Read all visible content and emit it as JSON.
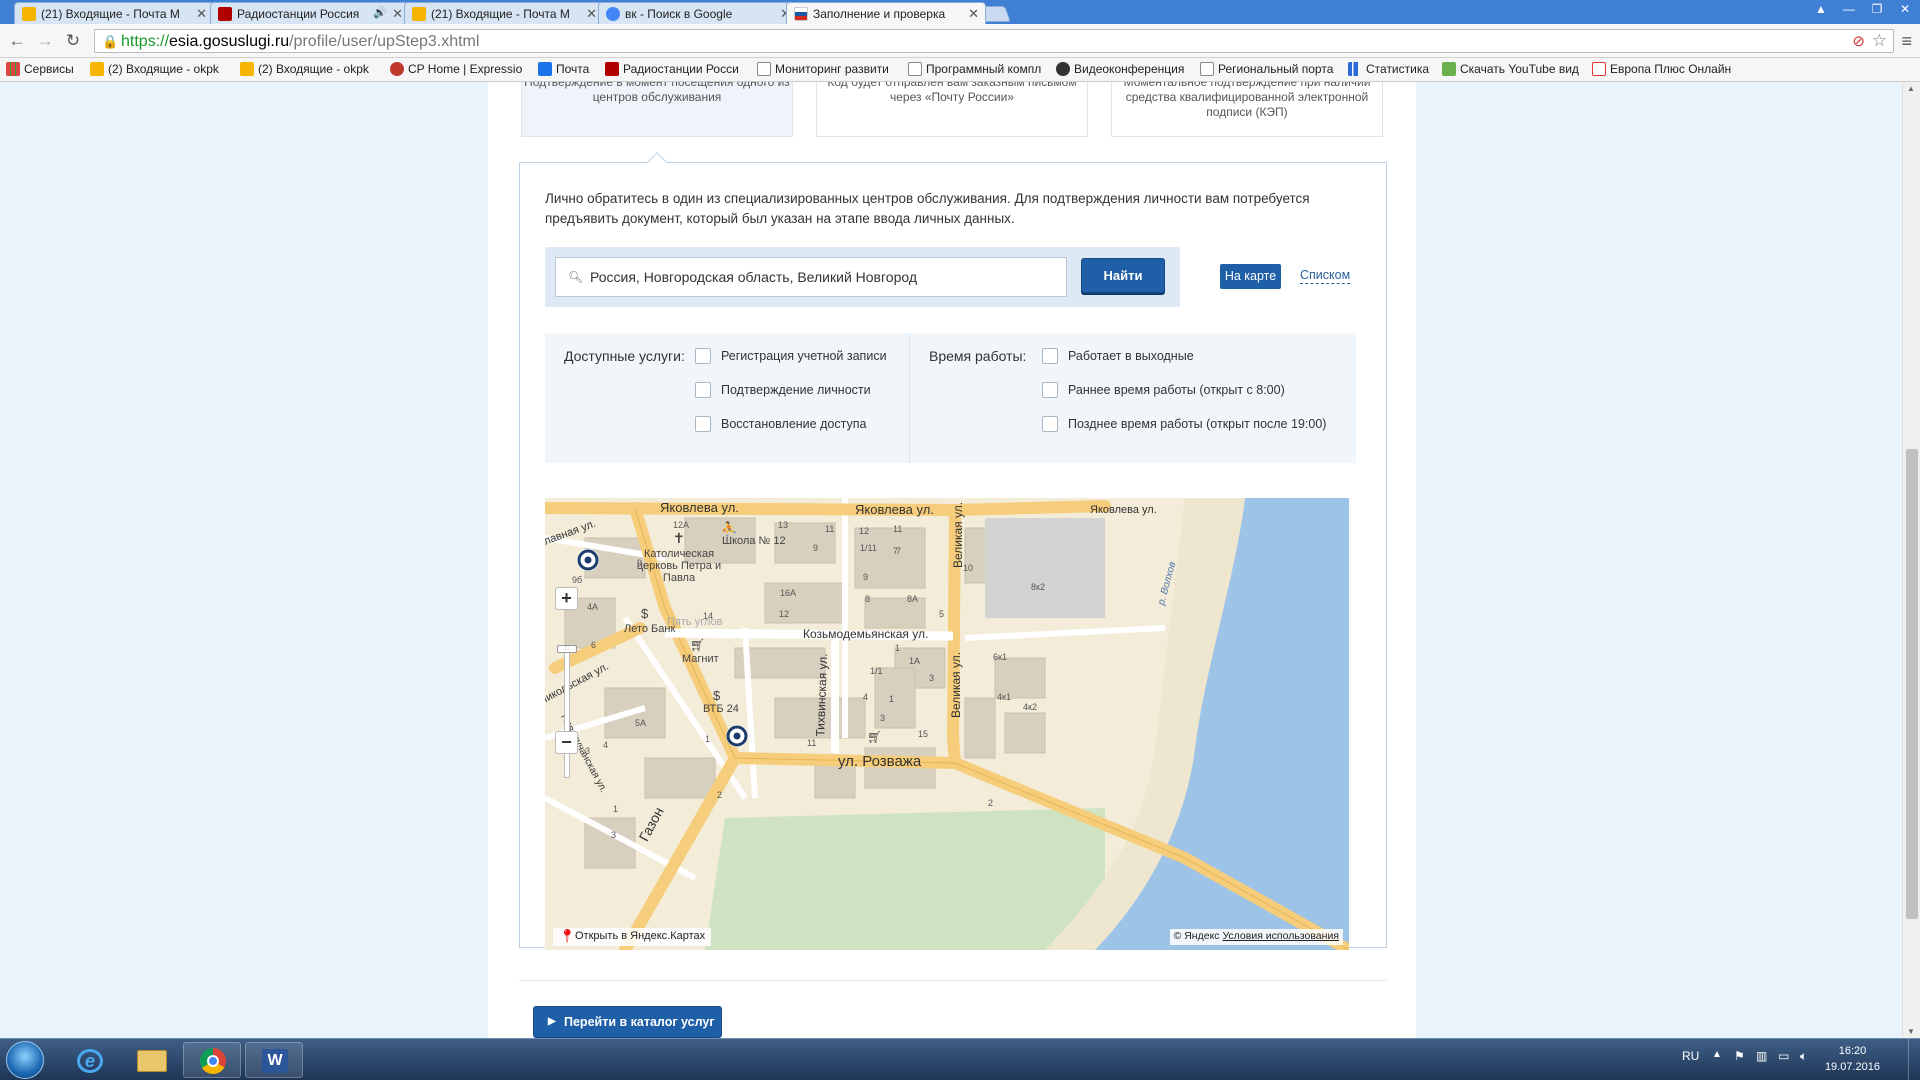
{
  "browser": {
    "tabs": [
      {
        "title": "(21) Входящие - Почта M",
        "icon_color": "#f5b400",
        "active": false,
        "audio": false
      },
      {
        "title": "Радиостанции Россия",
        "icon_color": "#b00000",
        "active": false,
        "audio": true
      },
      {
        "title": "(21) Входящие - Почта M",
        "icon_color": "#f5b400",
        "active": false,
        "audio": false
      },
      {
        "title": "вк - Поиск в Google",
        "icon_color": "#4285f4",
        "active": false,
        "audio": false
      },
      {
        "title": "Заполнение и проверка",
        "icon_color": "#1c57a5",
        "active": true,
        "audio": false
      }
    ],
    "url_scheme": "https://",
    "url_host": "esia.gosuslugi.ru",
    "url_path": "/profile/user/upStep3.xhtml",
    "bookmarks": [
      {
        "label": "Сервисы",
        "icon_color": "#d44"
      },
      {
        "label": "(2) Входящие - okpk",
        "icon_color": "#f5b400"
      },
      {
        "label": "(2) Входящие - okpk",
        "icon_color": "#f5b400"
      },
      {
        "label": "CP Home | Expressio",
        "icon_color": "#c0392b"
      },
      {
        "label": "Почта",
        "icon_color": "#1a73e8"
      },
      {
        "label": "Радиостанции Росси",
        "icon_color": "#b00000"
      },
      {
        "label": "Мониторинг развити",
        "icon_color": "#999"
      },
      {
        "label": "Программный компл",
        "icon_color": "#999"
      },
      {
        "label": "Видеоконференция",
        "icon_color": "#333"
      },
      {
        "label": "Региональный порта",
        "icon_color": "#999"
      },
      {
        "label": "Статистика",
        "icon_color": "#2a6ad6"
      },
      {
        "label": "Скачать YouTube вид",
        "icon_color": "#6ab04c"
      },
      {
        "label": "Европа Плюс Онлайн",
        "icon_color": "#d33"
      }
    ]
  },
  "page": {
    "options": [
      {
        "text": "Подтверждение в момент посещения одного из центров обслуживания"
      },
      {
        "text": "Код будет отправлен вам заказным письмом через «Почту России»"
      },
      {
        "text": "Моментальное подтверждение при наличии средства квалифицированной электронной подписи (КЭП)"
      }
    ],
    "intro": "Лично обратитесь в один из специализированных центров обслуживания. Для подтверждения личности вам потребуется предъявить документ, который был указан на этапе ввода личных данных.",
    "search": {
      "value": "Россия, Новгородская область, Великий Новгород",
      "button": "Найти"
    },
    "view_map": "На карте",
    "view_list": "Списком",
    "filters": {
      "services_title": "Доступные услуги:",
      "services": [
        "Регистрация учетной записи",
        "Подтверждение личности",
        "Восстановление доступа"
      ],
      "hours_title": "Время работы:",
      "hours": [
        "Работает в выходные",
        "Раннее время работы (открыт с 8:00)",
        "Позднее время работы (открыт после 19:00)"
      ]
    },
    "map": {
      "streets": [
        "Яковлева ул.",
        "Яковлева ул.",
        "Яковлева ул.",
        "Козьмодемьянская ул.",
        "ул. Розважа",
        "Тихвинская ул.",
        "Великая ул.",
        "Великая ул.",
        "Газон",
        "Новолучанская ул.",
        "Славная ул.",
        "Никольская ул.",
        "р. Волхов",
        "Пять углов"
      ],
      "pois": [
        "Школа № 12",
        "Католическая церковь Петра и Павла",
        "Лето Банк",
        "Магнит",
        "ВТБ 24"
      ],
      "house_numbers": [
        "12А",
        "13",
        "11",
        "12",
        "11",
        "9",
        "16А",
        "12",
        "14",
        "9",
        "7",
        "8",
        "8А",
        "5",
        "10",
        "8к2",
        "6к1",
        "4к1",
        "4к2",
        "3",
        "2",
        "1",
        "1А",
        "1/1",
        "4",
        "15",
        "11",
        "1",
        "3",
        "5А",
        "4",
        "6",
        "9б",
        "4А",
        "3",
        "1",
        "1/11",
        "7",
        "9",
        "3",
        "2",
        "1"
      ],
      "open_link": "Открыть в Яндекс.Картах",
      "copyright": "© Яндекс",
      "terms": "Условия использования"
    },
    "catalog_button": "Перейти в каталог услуг"
  },
  "taskbar": {
    "lang": "RU",
    "time": "16:20",
    "date": "19.07.2016"
  }
}
